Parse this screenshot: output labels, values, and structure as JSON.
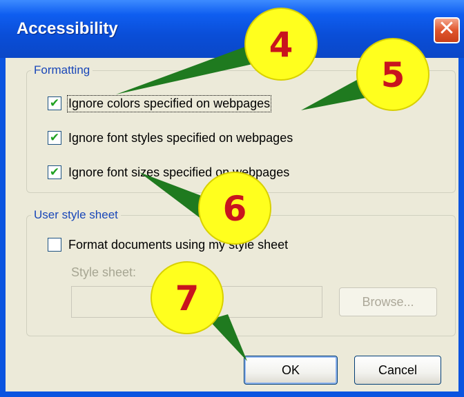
{
  "window": {
    "title": "Accessibility",
    "close_icon": "close-icon"
  },
  "formatting": {
    "group_label": "Formatting",
    "items": [
      {
        "label": "Ignore colors specified on webpages",
        "checked": true
      },
      {
        "label": "Ignore font styles specified on webpages",
        "checked": true
      },
      {
        "label": "Ignore font sizes specified on webpages",
        "checked": true
      }
    ]
  },
  "user_style": {
    "group_label": "User style sheet",
    "format_label": "Format documents using my style sheet",
    "format_checked": false,
    "style_sheet_label": "Style sheet:",
    "style_sheet_value": "",
    "browse_label": "Browse..."
  },
  "buttons": {
    "ok_label": "OK",
    "cancel_label": "Cancel"
  },
  "callouts": {
    "badge_color": "#ffff1e",
    "number_color": "#c8141e",
    "pointer_color": "#1f7a1f",
    "labels": [
      "4",
      "5",
      "6",
      "7"
    ]
  },
  "check_glyph": "✔"
}
